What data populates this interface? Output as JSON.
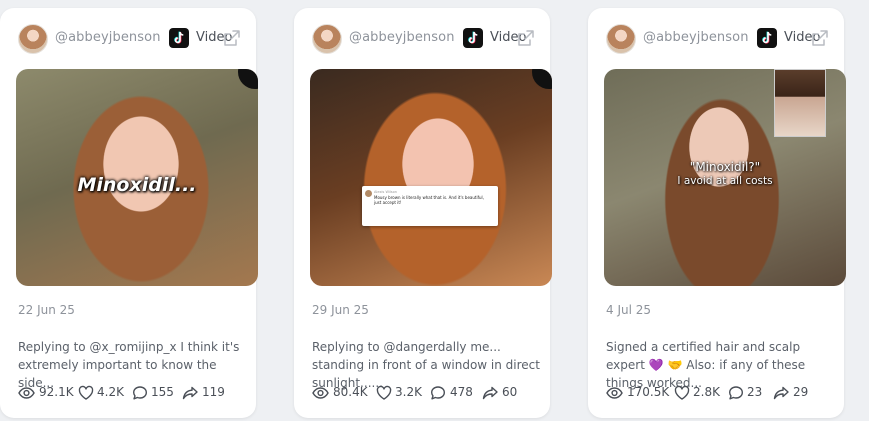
{
  "colors": {
    "card_bg": "#ffffff",
    "page_bg": "#eef0f3",
    "muted_text": "#8e939b",
    "body_text": "#5b616a",
    "tiktok_black": "#111111"
  },
  "cards": [
    {
      "handle": "@abbeyjbenson",
      "type_label": "Video",
      "platform_icon": "tiktok-icon",
      "overlay_text": "Minoxidil...",
      "date": "22 Jun 25",
      "description": "Replying to @x_romijinp_x I think it's extremely important to know the side...",
      "stats": {
        "views": "92.1K",
        "likes": "4.2K",
        "comments": "155",
        "shares": "119"
      }
    },
    {
      "handle": "@abbeyjbenson",
      "type_label": "Video",
      "platform_icon": "tiktok-icon",
      "comment_author": "Alexis Wilson",
      "comment_text": "Mousy brown is literally what that is. And it's beautiful, just accept it!",
      "date": "29 Jun 25",
      "description": "Replying to @dangerdally me... standing in front of a window in direct sunlight......",
      "stats": {
        "views": "80.4K",
        "likes": "3.2K",
        "comments": "478",
        "shares": "60"
      }
    },
    {
      "handle": "@abbeyjbenson",
      "type_label": "Video",
      "platform_icon": "tiktok-icon",
      "overlay_quote": "\"Minoxidil?\"",
      "overlay_sub": "I avoid at all costs",
      "date": "4 Jul 25",
      "description": "Signed a certified hair and scalp expert 💜 🤝 Also: if any of these things worked...",
      "stats": {
        "views": "170.5K",
        "likes": "2.8K",
        "comments": "23",
        "shares": "29"
      }
    }
  ]
}
